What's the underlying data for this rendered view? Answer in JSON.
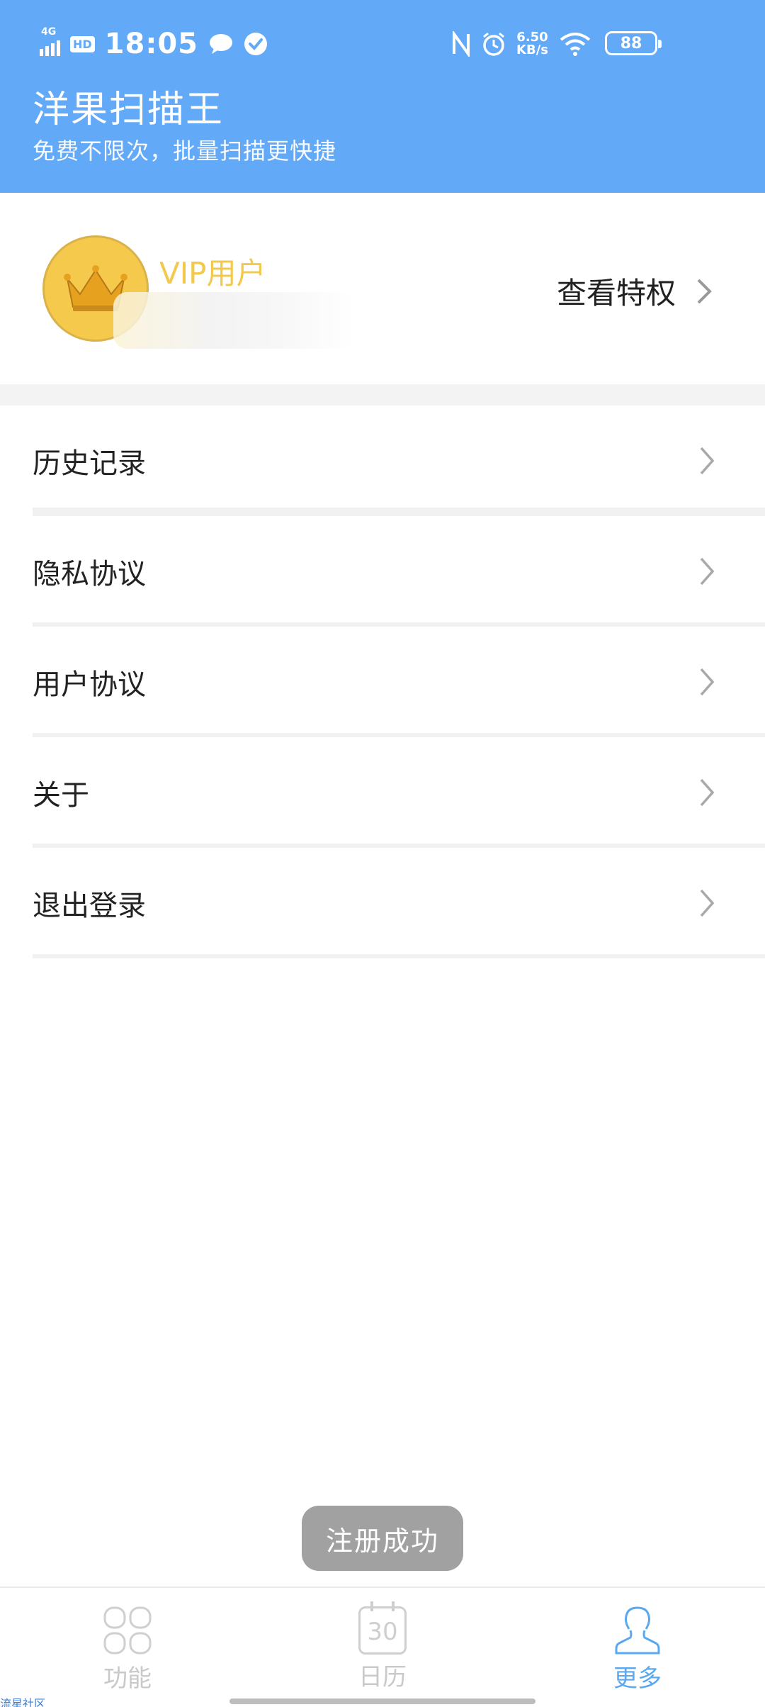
{
  "status_bar": {
    "network": "4G",
    "hd": "HD",
    "time": "18:05",
    "speed_value": "6.50",
    "speed_unit": "KB/s",
    "battery": "88"
  },
  "header": {
    "title": "洋果扫描王",
    "subtitle": "免费不限次，批量扫描更快捷"
  },
  "profile": {
    "vip_label": "VIP用户",
    "view_privileges": "查看特权"
  },
  "menu": {
    "items": [
      {
        "label": "历史记录"
      },
      {
        "label": "隐私协议"
      },
      {
        "label": "用户协议"
      },
      {
        "label": "关于"
      },
      {
        "label": "退出登录"
      }
    ]
  },
  "toast": "注册成功",
  "bottom_nav": {
    "tabs": [
      {
        "label": "功能"
      },
      {
        "label": "日历",
        "calendar_day": "30"
      },
      {
        "label": "更多"
      }
    ]
  },
  "watermark": "流星社区",
  "colors": {
    "header_bg": "#62a9f7",
    "accent": "#5aa8f0",
    "vip_gold": "#f2c94c"
  }
}
